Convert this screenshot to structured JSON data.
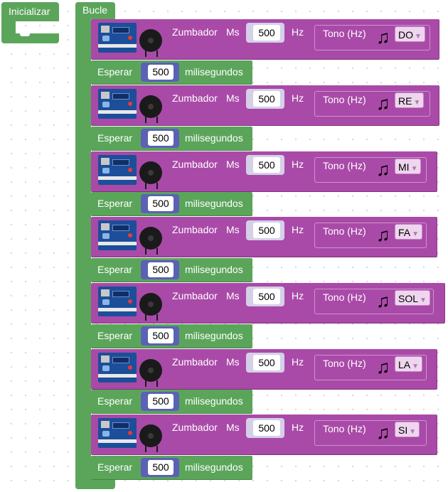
{
  "init_block": {
    "label": "Inicializar"
  },
  "loop_block": {
    "label": "Bucle"
  },
  "steps": [
    {
      "buzzer": {
        "label": "Zumbador",
        "ms_label": "Ms",
        "ms_value": "500",
        "hz_label": "Hz",
        "tone_label": "Tono (Hz)",
        "note_icon": "music-note-icon",
        "note": "DO"
      },
      "wait": {
        "label": "Esperar",
        "value": "500",
        "unit": "milisegundos"
      }
    },
    {
      "buzzer": {
        "label": "Zumbador",
        "ms_label": "Ms",
        "ms_value": "500",
        "hz_label": "Hz",
        "tone_label": "Tono (Hz)",
        "note_icon": "music-note-icon",
        "note": "RE"
      },
      "wait": {
        "label": "Esperar",
        "value": "500",
        "unit": "milisegundos"
      }
    },
    {
      "buzzer": {
        "label": "Zumbador",
        "ms_label": "Ms",
        "ms_value": "500",
        "hz_label": "Hz",
        "tone_label": "Tono (Hz)",
        "note_icon": "music-note-icon",
        "note": "MI"
      },
      "wait": {
        "label": "Esperar",
        "value": "500",
        "unit": "milisegundos"
      }
    },
    {
      "buzzer": {
        "label": "Zumbador",
        "ms_label": "Ms",
        "ms_value": "500",
        "hz_label": "Hz",
        "tone_label": "Tono (Hz)",
        "note_icon": "music-note-icon",
        "note": "FA"
      },
      "wait": {
        "label": "Esperar",
        "value": "500",
        "unit": "milisegundos"
      }
    },
    {
      "buzzer": {
        "label": "Zumbador",
        "ms_label": "Ms",
        "ms_value": "500",
        "hz_label": "Hz",
        "tone_label": "Tono (Hz)",
        "note_icon": "music-note-icon",
        "note": "SOL"
      },
      "wait": {
        "label": "Esperar",
        "value": "500",
        "unit": "milisegundos"
      }
    },
    {
      "buzzer": {
        "label": "Zumbador",
        "ms_label": "Ms",
        "ms_value": "500",
        "hz_label": "Hz",
        "tone_label": "Tono (Hz)",
        "note_icon": "music-note-icon",
        "note": "LA"
      },
      "wait": {
        "label": "Esperar",
        "value": "500",
        "unit": "milisegundos"
      }
    },
    {
      "buzzer": {
        "label": "Zumbador",
        "ms_label": "Ms",
        "ms_value": "500",
        "hz_label": "Hz",
        "tone_label": "Tono (Hz)",
        "note_icon": "music-note-icon",
        "note": "SI"
      },
      "wait": {
        "label": "Esperar",
        "value": "500",
        "unit": "milisegundos"
      }
    }
  ],
  "colors": {
    "control_green": "#5ba55b",
    "buzzer_purple": "#a94aa8",
    "number_input_blue": "#5b61b4",
    "background": "#ffffff"
  }
}
